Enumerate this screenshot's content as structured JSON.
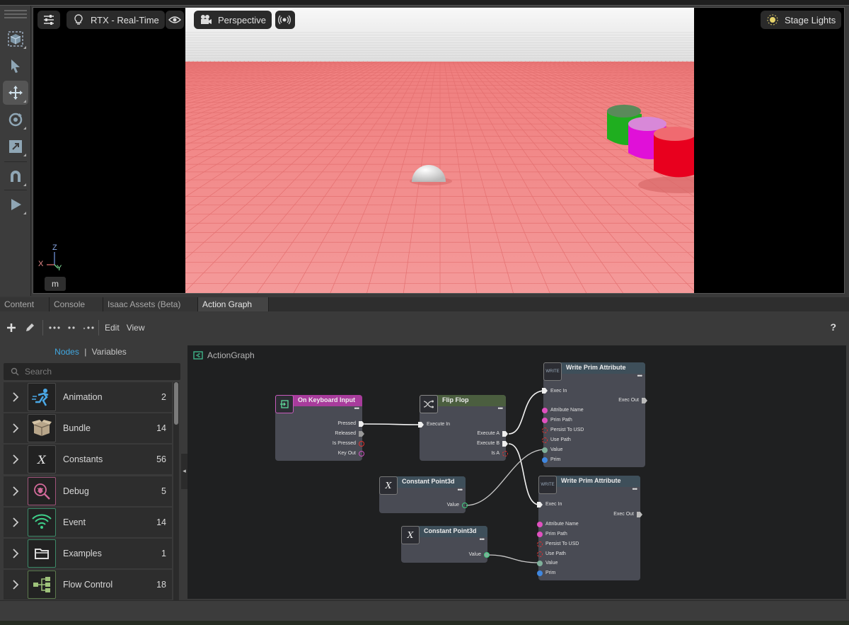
{
  "viewport": {
    "settings_icon": "sliders-icon",
    "renderer_label": "RTX - Real-Time",
    "camera_label": "Perspective",
    "lights_label": "Stage Lights",
    "axes": {
      "z": "Z",
      "x": "X",
      "y": "Y"
    },
    "unit": "m"
  },
  "tabs": [
    {
      "label": "Content"
    },
    {
      "label": "Console"
    },
    {
      "label": "Isaac Assets (Beta)"
    },
    {
      "label": "Action Graph"
    }
  ],
  "graph_toolbar": {
    "edit_label": "Edit",
    "view_label": "View",
    "help": "?"
  },
  "left_panel": {
    "tab_nodes": "Nodes",
    "tab_separator": "|",
    "tab_variables": "Variables",
    "search_placeholder": "Search",
    "categories": [
      {
        "name": "Animation",
        "count": "2",
        "icon": "running-figure-icon"
      },
      {
        "name": "Bundle",
        "count": "14",
        "icon": "box-icon"
      },
      {
        "name": "Constants",
        "count": "56",
        "icon": "x-variable-icon"
      },
      {
        "name": "Debug",
        "count": "5",
        "icon": "bug-magnifier-icon"
      },
      {
        "name": "Event",
        "count": "14",
        "icon": "wifi-signal-icon"
      },
      {
        "name": "Examples",
        "count": "1",
        "icon": "folder-icon"
      },
      {
        "name": "Flow Control",
        "count": "18",
        "icon": "flow-tree-icon"
      }
    ]
  },
  "graph": {
    "title": "ActionGraph",
    "nodes": {
      "keyboard": {
        "title": "On Keyboard Input",
        "outputs": [
          "Pressed",
          "Released",
          "Is Pressed",
          "Key Out"
        ]
      },
      "flipflop": {
        "title": "Flip Flop",
        "input": "Execute In",
        "outputs": [
          "Execute A",
          "Execute B",
          "Is A"
        ]
      },
      "write1": {
        "title": "Write Prim Attribute",
        "icon_text": "WRITE",
        "exec_in": "Exec In",
        "exec_out": "Exec Out",
        "inputs": [
          "Attribute Name",
          "Prim Path",
          "Persist To USD",
          "Use Path",
          "Value",
          "Prim"
        ]
      },
      "write2": {
        "title": "Write Prim Attribute",
        "icon_text": "WRITE",
        "exec_in": "Exec In",
        "exec_out": "Exec Out",
        "inputs": [
          "Attribute Name",
          "Prim Path",
          "Persist To USD",
          "Use Path",
          "Value",
          "Prim"
        ]
      },
      "const1": {
        "title": "Constant Point3d",
        "icon_text": "X",
        "output": "Value"
      },
      "const2": {
        "title": "Constant Point3d",
        "icon_text": "X",
        "output": "Value"
      }
    }
  },
  "colors": {
    "accent": "#41a7e0",
    "keyboard_header": "#a83c9c",
    "flipflop_header": "#4b5e3f",
    "write_header": "#3e4f5a",
    "const_header": "#3e4f5a",
    "floor": "#f39090"
  }
}
